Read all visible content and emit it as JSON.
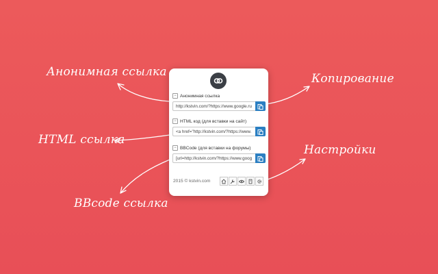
{
  "callouts": {
    "anon_link": "Анонимная ссылка",
    "html_link": "HTML ссылка",
    "bbcode_link": "BBcode ссылка",
    "copy": "Копирование",
    "settings": "Настройки"
  },
  "popup": {
    "logo_icon": "link-chain-icon",
    "sections": [
      {
        "label": "Анонимная ссылка",
        "value": "http://kstvin.com/?https://www.google.ru"
      },
      {
        "label": "HTML код (для вставки на сайт)",
        "value": "<a href=\"http://kstvin.com/?https://www."
      },
      {
        "label": "BBCode (для вставки на форумы)",
        "value": "[url=http://kstvin.com/?https://www.goog"
      }
    ],
    "copy_icon": "clipboard-icon",
    "footer_text": "2015 © kstvin.com",
    "footer_icons": [
      "home-icon",
      "tools-icon",
      "eye-icon",
      "book-icon",
      "gear-icon"
    ]
  },
  "colors": {
    "background": "#e9545a",
    "accent": "#2b7fc2",
    "logo": "#3b3f45"
  }
}
